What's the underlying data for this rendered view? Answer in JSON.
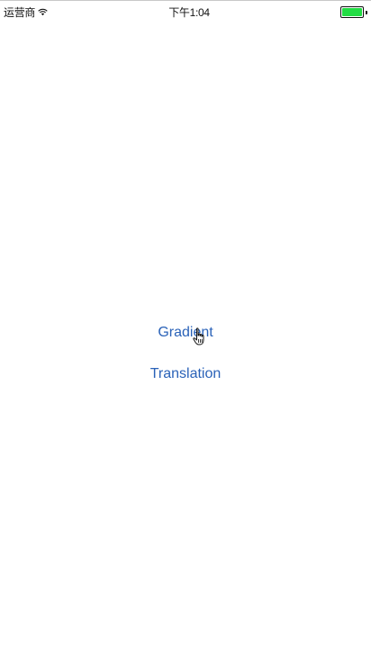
{
  "status_bar": {
    "carrier": "运营商",
    "time": "下午1:04",
    "battery_level": 1.0,
    "battery_color": "#22dd44"
  },
  "menu": {
    "items": [
      {
        "label": "Gradient"
      },
      {
        "label": "Translation"
      }
    ],
    "link_color": "#2a62b8"
  },
  "cursor": {
    "icon": "hand-pointer-icon"
  }
}
